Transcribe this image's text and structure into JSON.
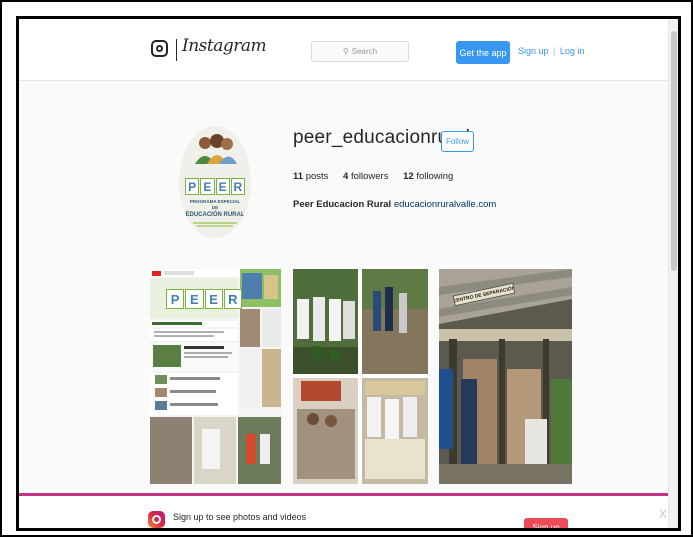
{
  "header": {
    "logo_wordmark": "Instagram",
    "search_placeholder": "Search",
    "get_app_label": "Get the app",
    "signup_label": "Sign up",
    "login_label": "Log in",
    "auth_separator": "|"
  },
  "profile": {
    "username": "peer_educacionrural",
    "follow_label": "Follow",
    "stats": [
      {
        "count": "11",
        "label": "posts"
      },
      {
        "count": "4",
        "label": "followers"
      },
      {
        "count": "12",
        "label": "following"
      }
    ],
    "bio_name": "Peer Educacion Rural",
    "bio_link": "educacionruralvalle.com",
    "avatar": {
      "letters": [
        "P",
        "E",
        "E",
        "R"
      ],
      "caption_line1": "PROGRAMA ESPECIAL DE",
      "caption_big": "EDUCACIÓN RURAL"
    }
  },
  "posts": [
    {
      "id": "post-1",
      "header_letters": [
        "P",
        "E",
        "E",
        "R"
      ]
    },
    {
      "id": "post-2"
    },
    {
      "id": "post-3",
      "sign_text": "CENTRO DE SEPARACIÓN"
    }
  ],
  "signup_banner": {
    "text": "Sign up to see photos and videos",
    "button_label": "Sign up",
    "close_glyph": "X"
  },
  "colors": {
    "primary_blue": "#3897f0",
    "signup_red": "#ed4956",
    "banner_border": "#c13584",
    "peer_green": "#7bb33c",
    "peer_blue": "#3f7fb8"
  }
}
